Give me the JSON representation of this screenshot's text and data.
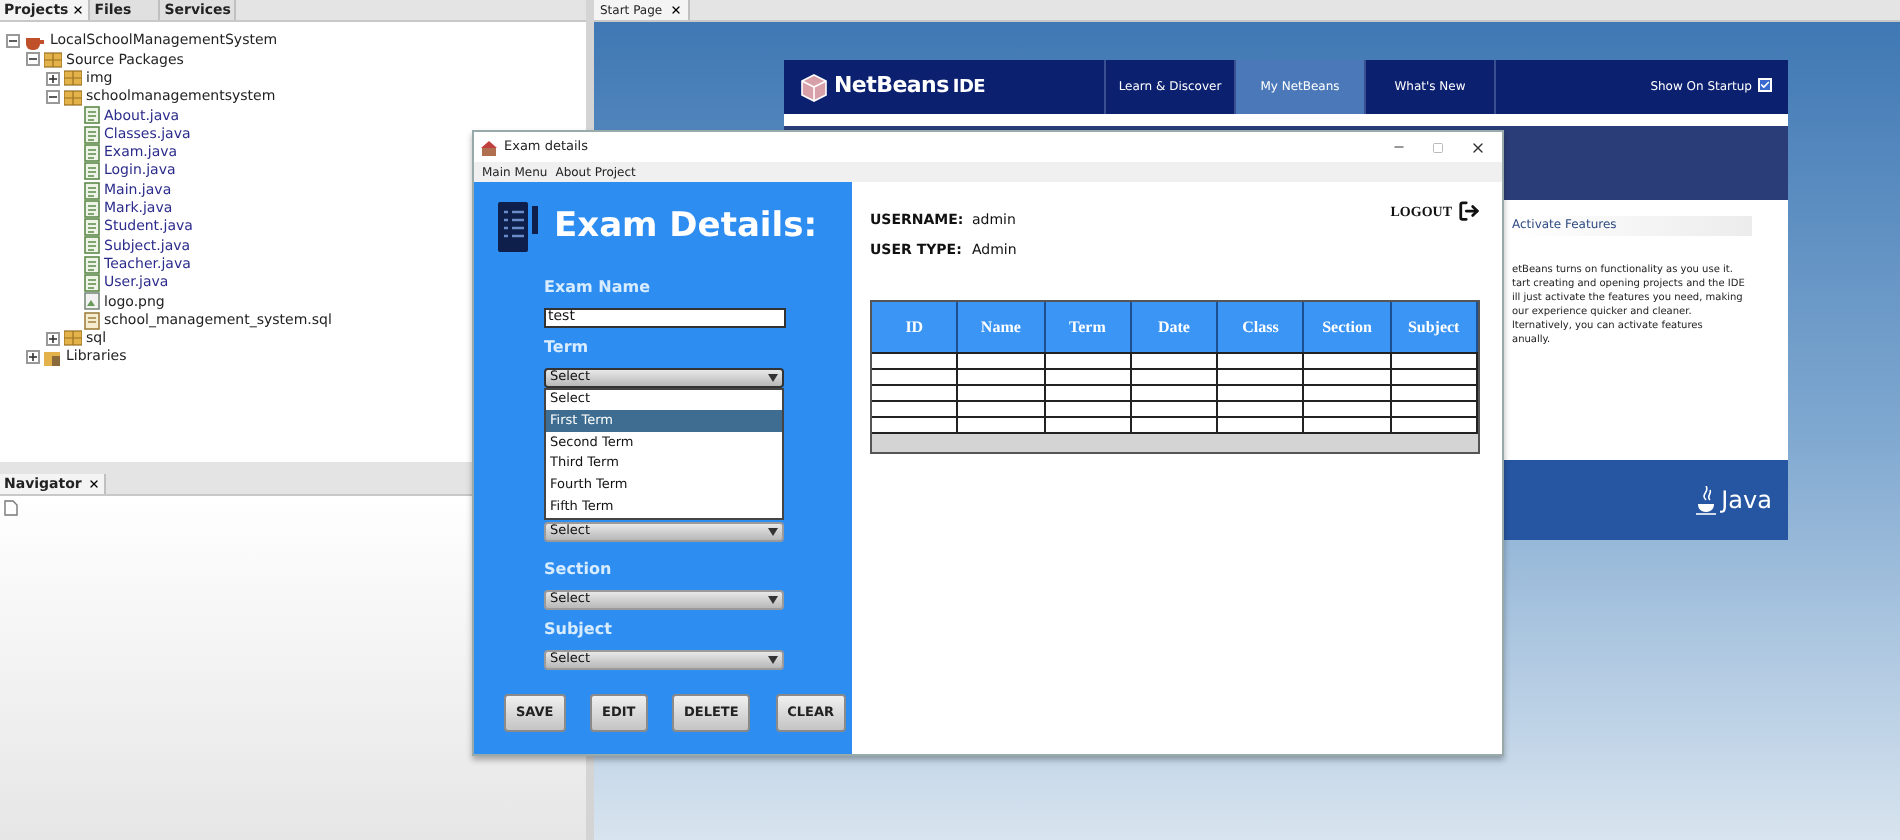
{
  "ide": {
    "left_tabs": [
      {
        "label": "Projects",
        "selected": true,
        "closable": true
      },
      {
        "label": "Files",
        "selected": false,
        "closable": false
      },
      {
        "label": "Services",
        "selected": false,
        "closable": false
      }
    ],
    "project_tree": [
      {
        "label": "LocalSchoolManagementSystem",
        "kind": "project",
        "expanded": true,
        "children": [
          {
            "label": "Source Packages",
            "kind": "folder",
            "expanded": true,
            "children": [
              {
                "label": "img",
                "kind": "package",
                "expanded": false
              },
              {
                "label": "schoolmanagementsystem",
                "kind": "package",
                "expanded": true,
                "children": [
                  {
                    "label": "About.java",
                    "kind": "java"
                  },
                  {
                    "label": "Classes.java",
                    "kind": "java"
                  },
                  {
                    "label": "Exam.java",
                    "kind": "java"
                  },
                  {
                    "label": "Login.java",
                    "kind": "java"
                  },
                  {
                    "label": "Main.java",
                    "kind": "java"
                  },
                  {
                    "label": "Mark.java",
                    "kind": "java"
                  },
                  {
                    "label": "Student.java",
                    "kind": "java"
                  },
                  {
                    "label": "Subject.java",
                    "kind": "java"
                  },
                  {
                    "label": "Teacher.java",
                    "kind": "java"
                  },
                  {
                    "label": "User.java",
                    "kind": "java"
                  },
                  {
                    "label": "logo.png",
                    "kind": "image"
                  },
                  {
                    "label": "school_management_system.sql",
                    "kind": "sql"
                  }
                ]
              },
              {
                "label": "sql",
                "kind": "package",
                "expanded": false
              }
            ]
          },
          {
            "label": "Libraries",
            "kind": "library",
            "expanded": false
          }
        ]
      }
    ],
    "navigator": {
      "title": "Navigator"
    },
    "editor_tabs": [
      {
        "label": "Start Page"
      }
    ],
    "start_page": {
      "logo": {
        "name": "NetBeans",
        "suffix": "IDE"
      },
      "nav": [
        {
          "label": "Learn & Discover",
          "selected": false
        },
        {
          "label": "My NetBeans",
          "selected": true
        },
        {
          "label": "What's New",
          "selected": false
        }
      ],
      "show_on_startup": {
        "label": "Show On Startup",
        "checked": true
      },
      "section_title": "Activate Features",
      "paragraph_lines": [
        "etBeans turns on functionality as you use it.",
        "tart creating and opening projects and the IDE",
        "ill just activate the features you need, making",
        "our experience quicker and cleaner.",
        "lternatively, you can activate features",
        "anually."
      ],
      "footer_logo": "Java"
    }
  },
  "dialog": {
    "title": "Exam details",
    "menu": [
      "Main Menu",
      "About Project"
    ],
    "heading": "Exam Details:",
    "fields": [
      {
        "kind": "text",
        "label": "Exam Name",
        "value": "test"
      },
      {
        "kind": "combo",
        "label": "Term",
        "value": "Select",
        "open": true,
        "options": [
          {
            "label": "Select",
            "highlighted": false
          },
          {
            "label": "First Term",
            "highlighted": true
          },
          {
            "label": "Second Term",
            "highlighted": false
          },
          {
            "label": "Third Term",
            "highlighted": false
          },
          {
            "label": "Fourth Term",
            "highlighted": false
          },
          {
            "label": "Fifth Term",
            "highlighted": false
          }
        ]
      },
      {
        "kind": "combo",
        "value": "Select",
        "open": false
      },
      {
        "kind": "combo",
        "label": "Section",
        "value": "Select",
        "open": false
      },
      {
        "kind": "combo",
        "label": "Subject",
        "value": "Select",
        "open": false
      }
    ],
    "buttons": [
      "SAVE",
      "EDIT",
      "DELETE",
      "CLEAR"
    ],
    "user": [
      {
        "label": "USERNAME:",
        "value": "admin"
      },
      {
        "label": "USER TYPE:",
        "value": "Admin"
      }
    ],
    "logout": "LOGOUT",
    "table": {
      "columns": [
        "ID",
        "Name",
        "Term",
        "Date",
        "Class",
        "Section",
        "Subject"
      ]
    }
  }
}
